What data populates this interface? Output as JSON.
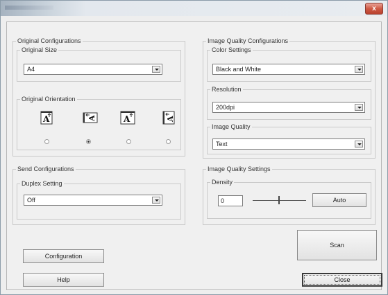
{
  "window": {
    "close_glyph": "x"
  },
  "original_configurations": {
    "title": "Original Configurations",
    "original_size": {
      "label": "Original Size",
      "value": "A4"
    },
    "orientation": {
      "label": "Original Orientation",
      "options": [
        "portrait-up",
        "landscape-left",
        "portrait-up-alt",
        "landscape-right"
      ],
      "selected_index": 1
    }
  },
  "image_quality_configurations": {
    "title": "Image Quality Configurations",
    "color_settings": {
      "label": "Color Settings",
      "value": "Black and White"
    },
    "resolution": {
      "label": "Resolution",
      "value": "200dpi"
    },
    "image_quality": {
      "label": "Image Quality",
      "value": "Text"
    }
  },
  "send_configurations": {
    "title": "Send Configurations",
    "duplex_setting": {
      "label": "Duplex Setting",
      "value": "Off"
    }
  },
  "image_quality_settings": {
    "title": "Image Quality Settings",
    "density": {
      "label": "Density",
      "value": "0",
      "auto_label": "Auto"
    }
  },
  "buttons": {
    "scan": "Scan",
    "configuration": "Configuration",
    "help": "Help",
    "close": "Close"
  }
}
